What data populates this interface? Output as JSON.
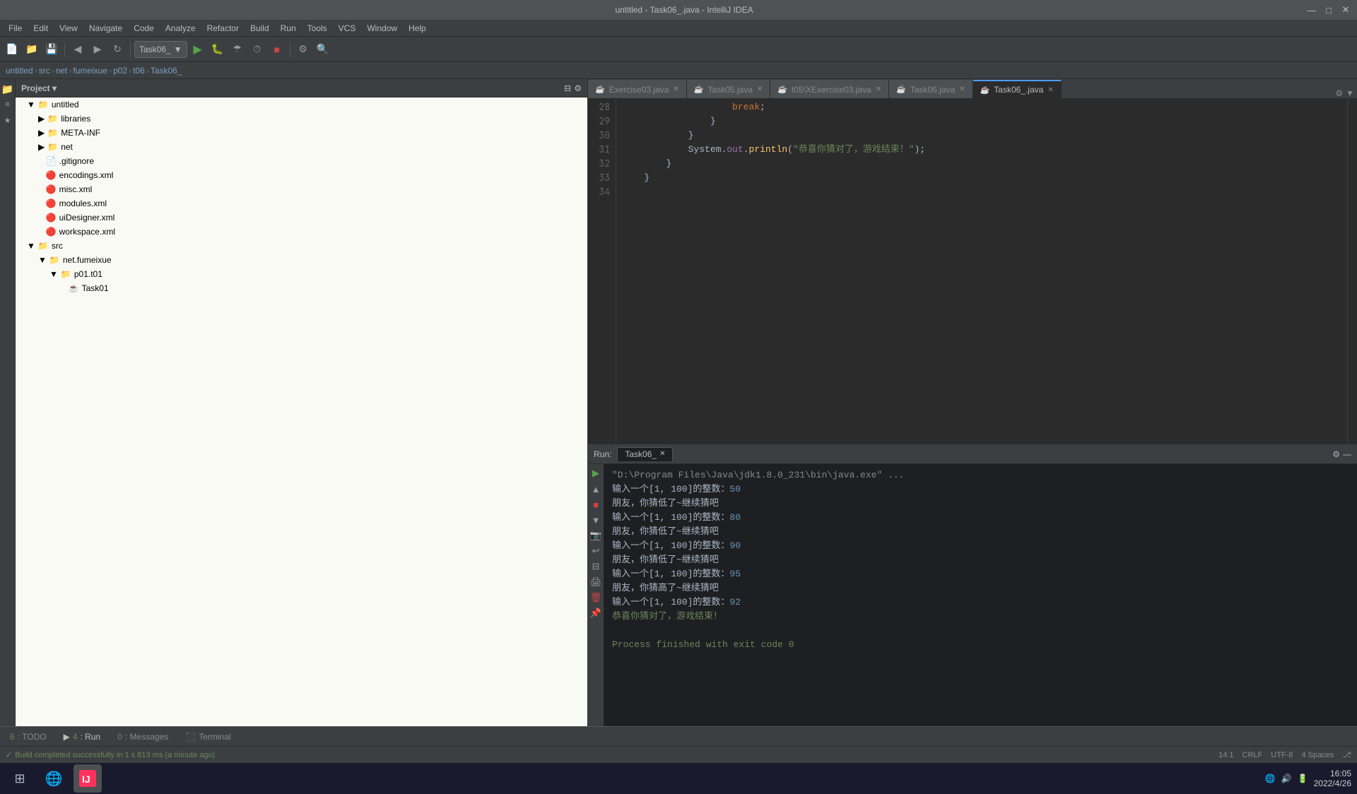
{
  "window": {
    "title": "untitled - Task06_.java - IntelliJ IDEA"
  },
  "titlebar": {
    "controls": [
      "—",
      "□",
      "✕"
    ]
  },
  "menubar": {
    "items": [
      "File",
      "Edit",
      "View",
      "Navigate",
      "Code",
      "Analyze",
      "Refactor",
      "Build",
      "Run",
      "Tools",
      "VCS",
      "Window",
      "Help"
    ]
  },
  "toolbar": {
    "dropdown_label": "Task06_"
  },
  "breadcrumb": {
    "items": [
      "untitled",
      "src",
      "net",
      "fumeixue",
      "p02",
      "t06",
      "Task06_"
    ]
  },
  "project_panel": {
    "title": "Project",
    "tree": [
      {
        "label": "untitled",
        "indent": 1,
        "type": "folder",
        "expanded": true
      },
      {
        "label": "libraries",
        "indent": 2,
        "type": "folder"
      },
      {
        "label": "META-INF",
        "indent": 2,
        "type": "folder"
      },
      {
        "label": "net",
        "indent": 2,
        "type": "folder"
      },
      {
        "label": ".gitignore",
        "indent": 2,
        "type": "git"
      },
      {
        "label": "encodings.xml",
        "indent": 2,
        "type": "xml"
      },
      {
        "label": "misc.xml",
        "indent": 2,
        "type": "xml"
      },
      {
        "label": "modules.xml",
        "indent": 2,
        "type": "xml"
      },
      {
        "label": "uiDesigner.xml",
        "indent": 2,
        "type": "xml"
      },
      {
        "label": "workspace.xml",
        "indent": 2,
        "type": "xml"
      },
      {
        "label": "src",
        "indent": 1,
        "type": "folder",
        "expanded": true
      },
      {
        "label": "net.fumeixue",
        "indent": 2,
        "type": "folder",
        "expanded": true
      },
      {
        "label": "p01.t01",
        "indent": 3,
        "type": "folder",
        "expanded": true
      },
      {
        "label": "Task01",
        "indent": 4,
        "type": "java"
      }
    ]
  },
  "editor_tabs": [
    {
      "label": "Exercise03.java",
      "active": false
    },
    {
      "label": "Task05.java",
      "active": false
    },
    {
      "label": "t05\\XExercise03.java",
      "active": false
    },
    {
      "label": "Task06.java",
      "active": false
    },
    {
      "label": "Task06_.java",
      "active": true
    }
  ],
  "code": {
    "lines": [
      {
        "num": 28,
        "content": "                    <kw>break</kw><cn>;</cn>"
      },
      {
        "num": 29,
        "content": "                <cn>}</cn>"
      },
      {
        "num": 30,
        "content": "            <cn>}</cn>"
      },
      {
        "num": 31,
        "content": "            <method>System</method><cn>.</cn><green>out</green><cn>.</cn><method>println</method><cn>(</cn><str>\"恭喜你猜对了，游戏结束！\"</str><cn>);</cn>"
      },
      {
        "num": 32,
        "content": "        <cn>}</cn>"
      },
      {
        "num": 33,
        "content": "    <cn>}</cn>"
      },
      {
        "num": 34,
        "content": ""
      }
    ]
  },
  "run_panel": {
    "label": "Run:",
    "tab_label": "Task06_",
    "output": [
      {
        "text": "\"D:\\Program Files\\Java\\jdk1.8.0_231\\bin\\java.exe\" ...",
        "type": "gray"
      },
      {
        "text": "输入一个[1, 100]的整数：50",
        "type": "normal",
        "highlight": "50"
      },
      {
        "text": "朋友，你猜低了~继续猜吧",
        "type": "normal"
      },
      {
        "text": "输入一个[1, 100]的整数：80",
        "type": "normal",
        "highlight": "80"
      },
      {
        "text": "朋友，你猜低了~继续猜吧",
        "type": "normal"
      },
      {
        "text": "输入一个[1, 100]的整数：90",
        "type": "normal",
        "highlight": "90"
      },
      {
        "text": "朋友，你猜低了~继续猜吧",
        "type": "normal"
      },
      {
        "text": "输入一个[1, 100]的整数：95",
        "type": "normal",
        "highlight": "95"
      },
      {
        "text": "朋友，你猜高了~继续猜吧",
        "type": "normal"
      },
      {
        "text": "输入一个[1, 100]的整数：92",
        "type": "normal",
        "highlight": "92"
      },
      {
        "text": "恭喜你猜对了，游戏结束！",
        "type": "green"
      },
      {
        "text": "",
        "type": "normal"
      },
      {
        "text": "Process finished with exit code 0",
        "type": "green"
      }
    ]
  },
  "tool_tabs": [
    {
      "num": "6",
      "label": "TODO"
    },
    {
      "num": "4",
      "label": "Run",
      "active": true
    },
    {
      "num": "0",
      "label": "Messages"
    },
    {
      "label": "Terminal"
    }
  ],
  "status_bar": {
    "build_status": "Build completed successfully in 1 s 813 ms (a minute ago)",
    "position": "14:1",
    "line_ending": "CRLF",
    "encoding": "UTF-8",
    "indent": "4 Spaces"
  },
  "taskbar": {
    "time": "16:05",
    "date": "2022/4/26"
  }
}
